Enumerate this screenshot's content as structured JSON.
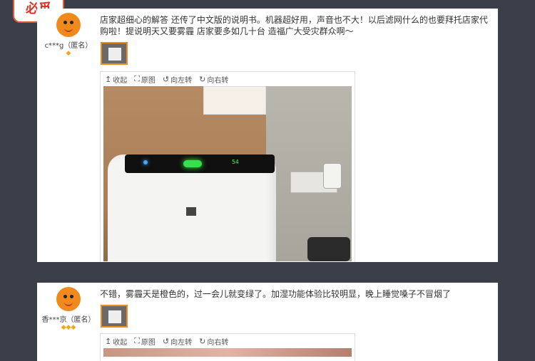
{
  "stamp": {
    "text": "必觅"
  },
  "toolbar": {
    "collapse": "收起",
    "original": "原图",
    "rotate_left": "向左转",
    "rotate_right": "向右转"
  },
  "reviews": [
    {
      "username": "c***g（匿名）",
      "rank_icons": "◆",
      "text": "店家超细心的解答 还传了中文版的说明书。机器超好用，声音也不大！以后滤网什么的也要拜托店家代购啦！提说明天又要雾霾 店家要多如几十台 造福广大受灾群众啊～",
      "photo_display": {
        "digits": "54"
      }
    },
    {
      "username": "香***京（匿名）",
      "rank_icons": "◆◆◆",
      "text": "不错，雾霾天是橙色的，过一会儿就变绿了。加湿功能体验比较明显，晚上睡觉嗓子不冒烟了"
    }
  ],
  "colors": {
    "background": "#3b3f4a",
    "accent": "#f08a1c",
    "stamp_red": "#d8342a"
  }
}
